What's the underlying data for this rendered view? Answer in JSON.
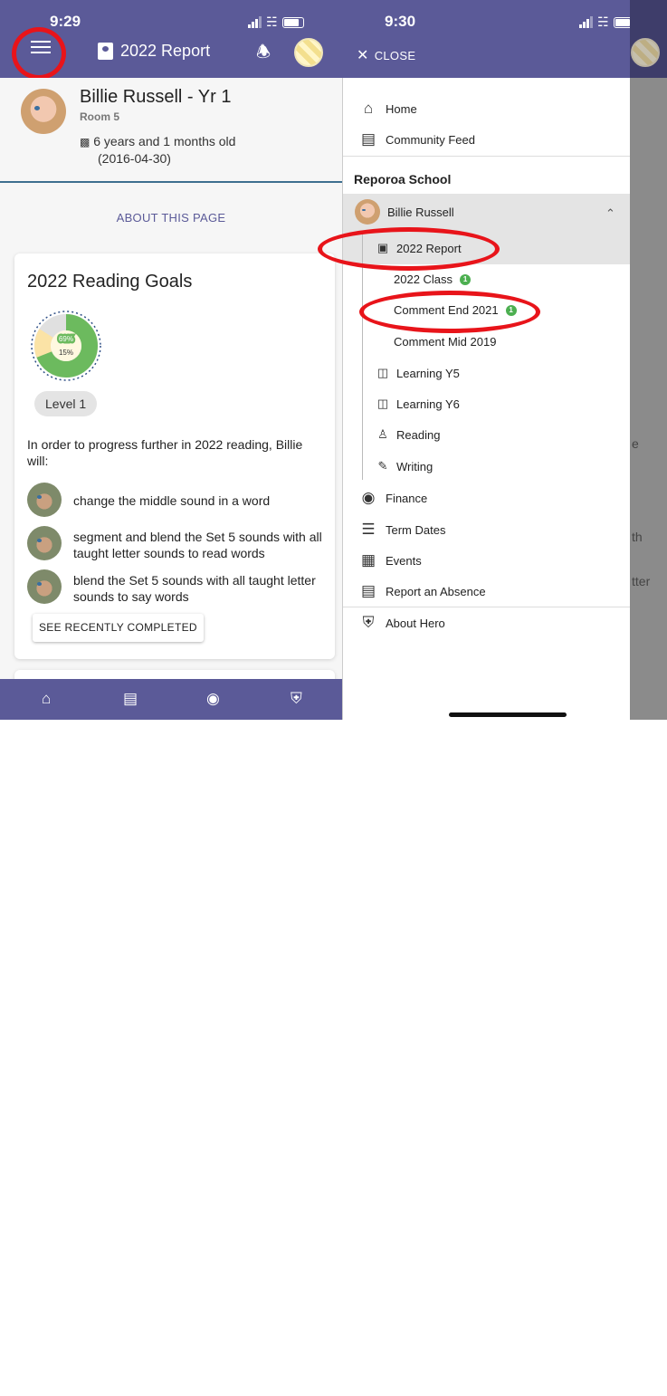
{
  "left": {
    "status": {
      "time": "9:29"
    },
    "header": {
      "title": "2022 Report"
    },
    "student": {
      "name": "Billie Russell - Yr 1",
      "room": "Room 5",
      "age": "6 years and 1 months old",
      "dob": "(2016-04-30)"
    },
    "about_link": "ABOUT THIS PAGE",
    "card": {
      "title": "2022 Reading Goals",
      "donut": {
        "achieved_pct": "69%",
        "in_progress_pct": "15%",
        "achieved": 0.69,
        "in_progress": 0.15
      },
      "level": "Level 1",
      "progress_text": "In order to progress further in 2022 reading, Billie will:",
      "goals": [
        {
          "text": "change the middle sound in a word"
        },
        {
          "text": "segment and blend the Set 5 sounds with all taught letter sounds to read words"
        },
        {
          "text": "blend the Set 5 sounds with all taught letter sounds to say words"
        }
      ],
      "see_button": "SEE RECENTLY COMPLETED"
    }
  },
  "right": {
    "status": {
      "time": "9:30"
    },
    "close_label": "CLOSE",
    "menu": {
      "home": "Home",
      "community_feed": "Community Feed",
      "school": "Reporoa School",
      "student": "Billie Russell",
      "items": [
        {
          "label": "2022 Report"
        },
        {
          "label": "2022 Class",
          "badge": "1"
        },
        {
          "label": "Comment End 2021",
          "badge": "1"
        },
        {
          "label": "Comment Mid 2019"
        },
        {
          "label": "Learning Y5"
        },
        {
          "label": "Learning Y6"
        },
        {
          "label": "Reading"
        },
        {
          "label": "Writing"
        }
      ],
      "finance": "Finance",
      "term_dates": "Term Dates",
      "events": "Events",
      "report_absence": "Report an Absence",
      "about_hero": "About Hero"
    },
    "dim_fragments": [
      "e",
      "th",
      "tter"
    ]
  },
  "colors": {
    "brand": "#5b5a98",
    "highlight": "#e8141a",
    "success": "#4caf50"
  }
}
